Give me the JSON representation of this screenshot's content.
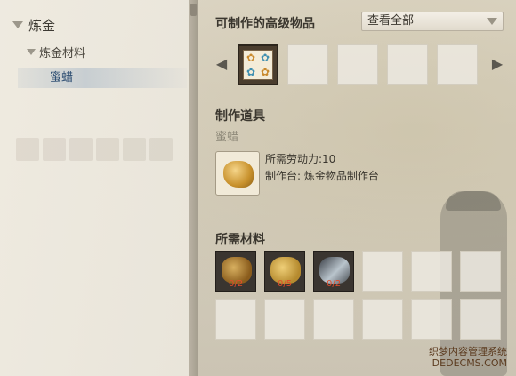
{
  "left": {
    "category": "炼金",
    "subcategory": "炼金材料",
    "selected_item": "蜜蜡"
  },
  "right": {
    "craftable_title": "可制作的高级物品",
    "filter": {
      "value": "查看全部"
    },
    "nav_left": "◀",
    "nav_right": "▶",
    "crafting_tool_title": "制作道具",
    "item_name": "蜜蜡",
    "labor_cost": "所需劳动力:10",
    "workbench": "制作台: 炼金物品制作台",
    "materials_title": "所需材料",
    "materials": [
      {
        "icon": "beeswax-comb-icon",
        "count": "0/2"
      },
      {
        "icon": "sponge-icon",
        "count": "0/5"
      },
      {
        "icon": "silver-fish-icon",
        "count": "0/2"
      }
    ]
  },
  "watermark": {
    "line1": "织梦内容管理系统",
    "line2": "DEDECMS.COM"
  }
}
